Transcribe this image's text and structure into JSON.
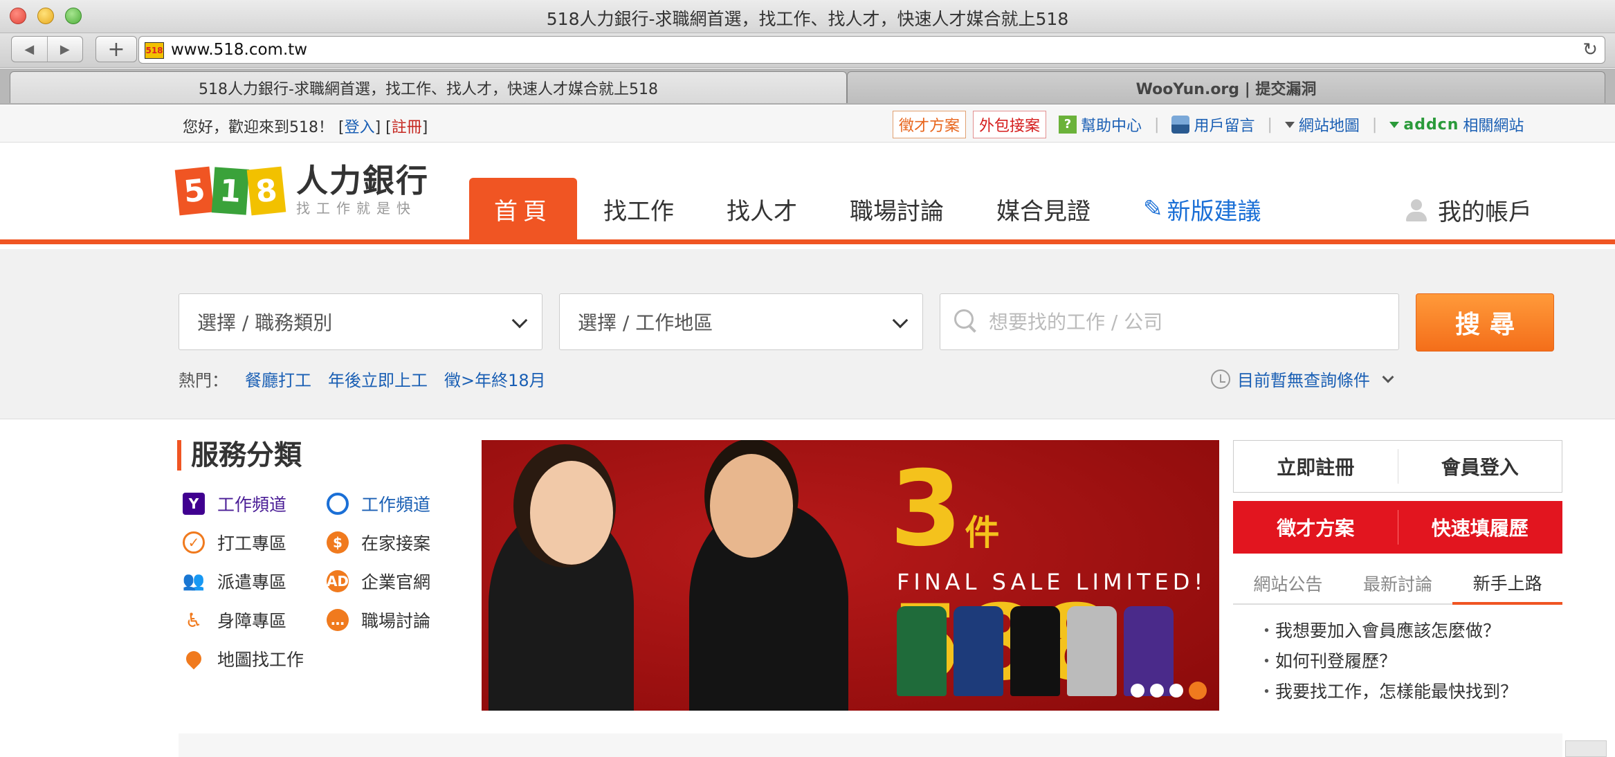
{
  "browser": {
    "window_title": "518人力銀行-求職網首選，找工作、找人才，快速人才媒合就上518",
    "url": "www.518.com.tw",
    "tabs": [
      {
        "label": "518人力銀行-求職網首選，找工作、找人才，快速人才媒合就上518"
      },
      {
        "label": "WooYun.org | 提交漏洞"
      }
    ]
  },
  "topstrip": {
    "welcome": "您好，歡迎來到518！",
    "login": "登入",
    "register": "註冊",
    "links": {
      "recruit_plan": "徵才方案",
      "outsource": "外包接案",
      "help": "幫助中心",
      "feedback": "用戶留言",
      "sitemap": "網站地圖",
      "addcn_logo": "addcn",
      "related": "相關網站"
    }
  },
  "header": {
    "logo_digits": [
      "5",
      "1",
      "8"
    ],
    "logo_main": "人力銀行",
    "logo_sub": "找工作就是快",
    "nav": {
      "home": "首頁",
      "find_job": "找工作",
      "find_talent": "找人才",
      "forum": "職場討論",
      "match": "媒合見證",
      "suggest": "新版建議"
    },
    "account": "我的帳戶"
  },
  "search": {
    "category": "選擇 / 職務類別",
    "area": "選擇 / 工作地區",
    "placeholder": "想要找的工作 / 公司",
    "button": "搜尋",
    "hot_label": "熱門：",
    "hot": [
      "餐廳打工",
      "年後立即上工",
      "徵>年終18月"
    ],
    "query_status": "目前暫無查詢條件"
  },
  "services": {
    "title": "服務分類",
    "items": [
      "工作頻道",
      "工作頻道",
      "打工專區",
      "在家接案",
      "派遣專區",
      "企業官網",
      "身障專區",
      "職場討論",
      "地圖找工作"
    ]
  },
  "banner": {
    "headline_num1": "3",
    "headline_unit": "件",
    "headline_num2": "588",
    "subline": "FINAL SALE LIMITED!",
    "slides_total": 4,
    "active_slide": 4
  },
  "sidebar": {
    "signup": "立即註冊",
    "login": "會員登入",
    "recruit_plan": "徵才方案",
    "resume": "快速填履歷",
    "tabs": [
      "網站公告",
      "最新討論",
      "新手上路"
    ],
    "active_tab": "新手上路",
    "news": [
      "我想要加入會員應該怎麼做？",
      "如何刊登履歷？",
      "我要找工作，怎樣能最快找到？"
    ]
  },
  "colors": {
    "accent": "#f05523",
    "link": "#1a5fb4",
    "search_button": "#f46e1a",
    "cta_red": "#e2151f"
  }
}
